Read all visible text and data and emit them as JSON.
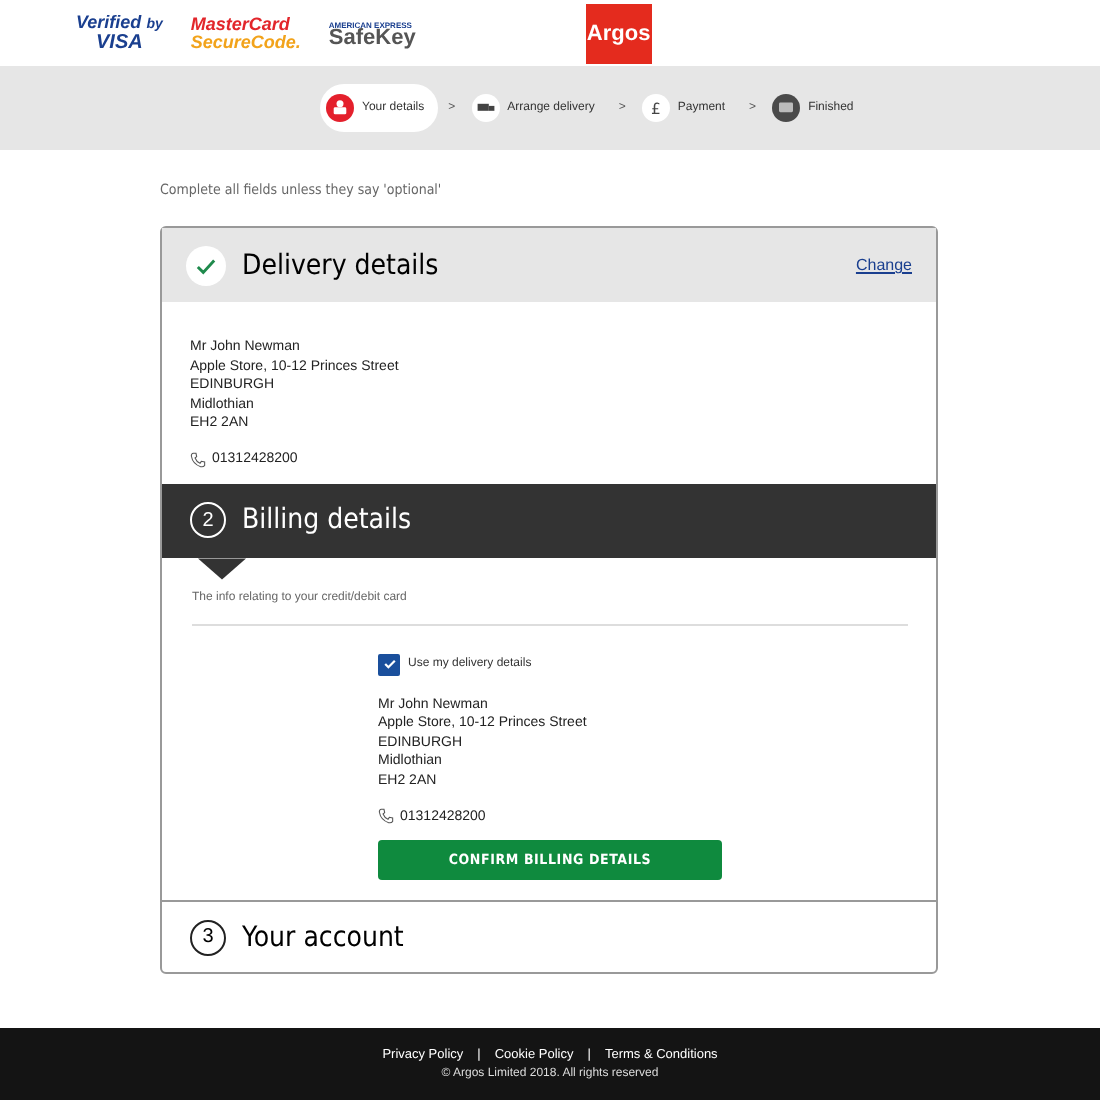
{
  "badges": {
    "visa": {
      "line1": "Verified",
      "line1_small": "by",
      "line2": "VISA"
    },
    "mastercard": {
      "line1": "MasterCard",
      "line2": "SecureCode."
    },
    "amex": {
      "line1": "AMERICAN EXPRESS",
      "line2": "SafeKey"
    },
    "brand": "Argos"
  },
  "progress": [
    {
      "label": "Your details",
      "selected": true,
      "separator": ">"
    },
    {
      "label": "Arrange delivery",
      "selected": false,
      "separator": ">"
    },
    {
      "label": "Payment",
      "selected": false,
      "separator": ">",
      "icon_text": "£"
    },
    {
      "label": "Finished",
      "selected": false
    }
  ],
  "instruction": "Complete all fields unless they say 'optional'",
  "sections": [
    {
      "kind": "completed",
      "title": "Delivery details",
      "link": "Change",
      "address": [
        "Mr John Newman",
        "Apple Store, 10-12 Princes Street",
        "EDINBURGH",
        "Midlothian",
        "EH2 2AN"
      ],
      "phone": "01312428200"
    },
    {
      "kind": "active",
      "number": "2",
      "title": "Billing details",
      "intro": "The info relating to your credit/debit card",
      "checkbox": {
        "label": "Use my delivery details",
        "checked": true
      },
      "address": [
        "Mr John Newman",
        "Apple Store, 10-12 Princes Street",
        "EDINBURGH",
        "Midlothian",
        "EH2 2AN"
      ],
      "phone": "01312428200",
      "button": "CONFIRM BILLING DETAILS"
    },
    {
      "kind": "collapsed",
      "number": "3",
      "title": "Your account"
    }
  ],
  "footer": {
    "links": [
      {
        "label": "Privacy Policy",
        "separator": "|"
      },
      {
        "label": "Cookie Policy",
        "separator": "|"
      },
      {
        "label": "Terms & Conditions"
      }
    ],
    "copyright": "© Argos Limited 2018. All rights reserved"
  }
}
